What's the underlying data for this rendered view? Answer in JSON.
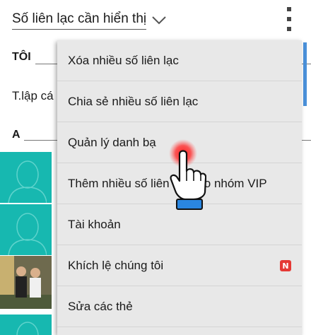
{
  "header": {
    "title": "Số liên lạc cần hiển thị",
    "chevron_icon": "chevron-down-icon",
    "overflow_icon": "more-vert-icon"
  },
  "list": {
    "section_me": "TÔI",
    "profile_row_partial": "T.lập cá",
    "section_a": "A"
  },
  "menu": {
    "items": [
      {
        "label": "Xóa nhiều số liên lạc"
      },
      {
        "label": "Chia sẻ nhiều số liên lạc"
      },
      {
        "label": "Quản lý danh bạ"
      },
      {
        "label": "Thêm nhiều số liên lạc vào nhóm VIP"
      },
      {
        "label": "Tài khoản"
      },
      {
        "label": "Khích lệ chúng tôi",
        "badge": "N"
      },
      {
        "label": "Sửa các thẻ"
      }
    ]
  },
  "colors": {
    "avatar_bg": "#17b8b0",
    "menu_bg": "#e8e8e8",
    "badge": "#e53935",
    "scrollbar": "#4a90d9",
    "tap_indicator": "#ff2020"
  }
}
